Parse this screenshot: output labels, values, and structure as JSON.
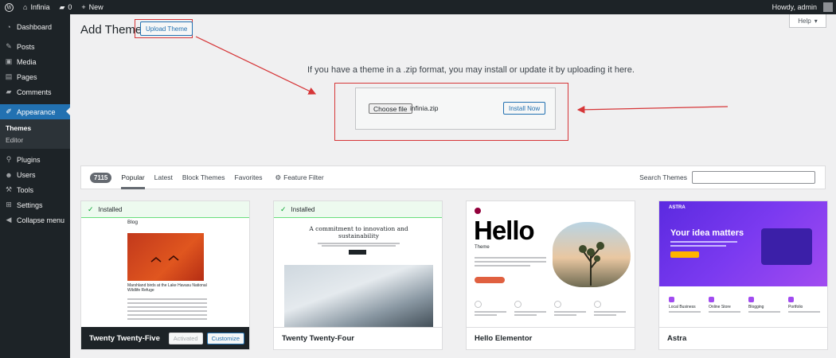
{
  "adminbar": {
    "site_name": "Infinia",
    "comments_count": "0",
    "new_label": "New",
    "howdy": "Howdy, admin"
  },
  "sidebar": {
    "items": [
      {
        "label": "Dashboard",
        "icon": "dashboard-icon"
      },
      {
        "label": "Posts",
        "icon": "pin-icon"
      },
      {
        "label": "Media",
        "icon": "media-icon"
      },
      {
        "label": "Pages",
        "icon": "pages-icon"
      },
      {
        "label": "Comments",
        "icon": "comments-icon"
      },
      {
        "label": "Appearance",
        "icon": "brush-icon"
      },
      {
        "label": "Plugins",
        "icon": "plugin-icon"
      },
      {
        "label": "Users",
        "icon": "users-icon"
      },
      {
        "label": "Tools",
        "icon": "wrench-icon"
      },
      {
        "label": "Settings",
        "icon": "settings-icon"
      },
      {
        "label": "Collapse menu",
        "icon": "collapse-icon"
      }
    ],
    "submenu": [
      "Themes",
      "Editor"
    ]
  },
  "page": {
    "title": "Add Themes",
    "upload_button": "Upload Theme",
    "help": "Help",
    "upload_desc": "If you have a theme in a .zip format, you may install or update it by uploading it here.",
    "choose_file": "Choose file",
    "file_name": "infinia.zip",
    "install_now": "Install Now"
  },
  "filter": {
    "count": "7115",
    "tabs": [
      "Popular",
      "Latest",
      "Block Themes",
      "Favorites"
    ],
    "feature_filter": "Feature Filter",
    "search_label": "Search Themes",
    "search_value": ""
  },
  "themes": [
    {
      "name": "Twenty Twenty-Five",
      "installed": "Installed",
      "activated": "Activated",
      "customize": "Customize",
      "preview_blog": "Blog",
      "preview_caption": "Marshland birds at the Lake Havasu National Wildlife Refuge"
    },
    {
      "name": "Twenty Twenty-Four",
      "installed": "Installed",
      "preview_title": "A commitment to innovation and sustainability"
    },
    {
      "name": "Hello Elementor",
      "preview_title": "Hello",
      "preview_sub": "Theme"
    },
    {
      "name": "Astra",
      "preview_logo": "ASTRA",
      "preview_title": "Your idea matters",
      "preview_cols": [
        "Local Business",
        "Online Store",
        "Blogging",
        "Portfolio"
      ]
    }
  ],
  "colors": {
    "accent": "#2271b1",
    "highlight": "#d63638",
    "sidebar_bg": "#1d2327"
  }
}
